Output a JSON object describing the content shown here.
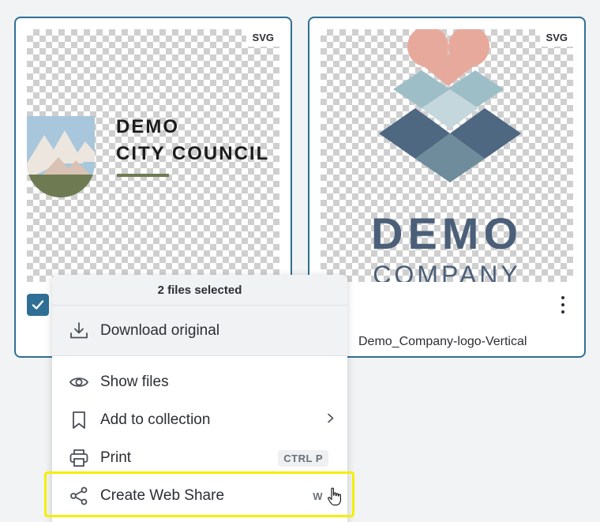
{
  "cards": [
    {
      "format_badge": "SVG",
      "selected": true,
      "logo": {
        "line1": "DEMO",
        "line2": "CITY COUNCIL"
      },
      "colors": {
        "sky": "#a9c7dc",
        "mountain_light": "#ece6df",
        "mountain_mid": "#d9c2b3",
        "ground": "#6e7b52",
        "text": "#1c1c1c"
      }
    },
    {
      "format_badge": "SVG",
      "filename": "Demo_Company-logo-Vertical",
      "logo": {
        "line1": "DEMO",
        "line2": "COMPANY"
      },
      "colors": {
        "heart": "#e8a99d",
        "teal_light": "#9dbec6",
        "slate_dark": "#4e6882",
        "slate_mid": "#6e8c9c",
        "text": "#4b5f78"
      }
    }
  ],
  "context_menu": {
    "header": "2 files selected",
    "items": [
      {
        "label": "Download original",
        "icon": "download-icon"
      },
      {
        "label": "Show files",
        "icon": "eye-icon"
      },
      {
        "label": "Add to collection",
        "icon": "bookmark-icon",
        "submenu_icon": "chevron-right-icon"
      },
      {
        "label": "Print",
        "icon": "printer-icon",
        "shortcut": "CTRL P"
      },
      {
        "label": "Create Web Share",
        "icon": "share-icon",
        "shortcut": "W"
      }
    ]
  },
  "colors": {
    "accent": "#2f6f95",
    "highlight": "#f5ee00",
    "background": "#f2f3f4"
  }
}
